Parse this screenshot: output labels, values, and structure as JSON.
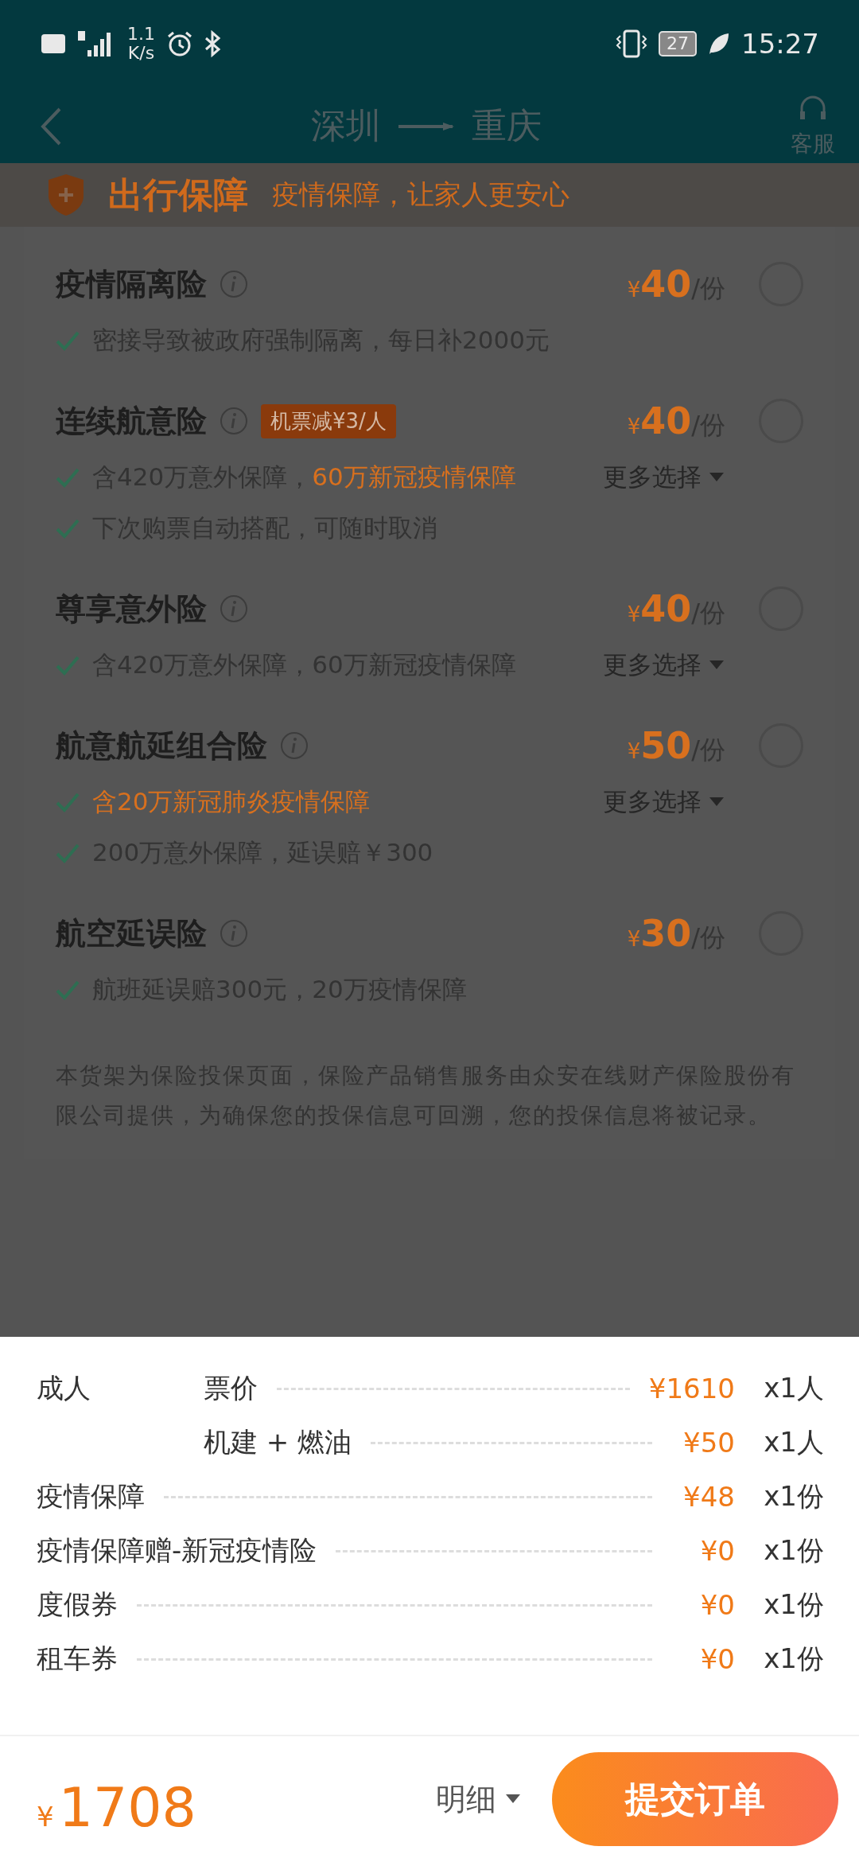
{
  "status_bar": {
    "network_speed": "1.1",
    "speed_unit": "K/s",
    "battery": "27",
    "time": "15:27"
  },
  "header": {
    "from": "深圳",
    "to": "重庆",
    "service_label": "客服"
  },
  "section": {
    "title": "出行保障",
    "subtitle": "疫情保障，让家人更安心"
  },
  "products": [
    {
      "name": "疫情隔离险",
      "currency": "¥",
      "price": "40",
      "unit": "/份",
      "selected": false,
      "lines": [
        {
          "segments": [
            {
              "text": "密接导致被政府强制隔离，每日补2000元",
              "highlight": false
            }
          ]
        }
      ]
    },
    {
      "name": "连续航意险",
      "badge": "机票减¥3/人",
      "currency": "¥",
      "price": "40",
      "unit": "/份",
      "selected": false,
      "lines": [
        {
          "segments": [
            {
              "text": "含420万意外保障，",
              "highlight": false
            },
            {
              "text": "60万新冠疫情保障",
              "highlight": true
            }
          ],
          "more": "更多选择"
        },
        {
          "segments": [
            {
              "text": "下次购票自动搭配，可随时取消",
              "highlight": false
            }
          ]
        }
      ]
    },
    {
      "name": "尊享意外险",
      "currency": "¥",
      "price": "40",
      "unit": "/份",
      "selected": false,
      "lines": [
        {
          "segments": [
            {
              "text": "含420万意外保障，60万新冠疫情保障",
              "highlight": false
            }
          ],
          "more": "更多选择"
        }
      ]
    },
    {
      "name": "航意航延组合险",
      "currency": "¥",
      "price": "50",
      "unit": "/份",
      "selected": false,
      "lines": [
        {
          "segments": [
            {
              "text": "含20万新冠肺炎疫情保障",
              "highlight": true
            }
          ],
          "more": "更多选择"
        },
        {
          "segments": [
            {
              "text": "200万意外保障，延误赔￥300",
              "highlight": false
            }
          ]
        }
      ]
    },
    {
      "name": "航空延误险",
      "currency": "¥",
      "price": "30",
      "unit": "/份",
      "selected": false,
      "lines": [
        {
          "segments": [
            {
              "text": "航班延误赔300元，20万疫情保障",
              "highlight": false
            }
          ]
        }
      ]
    }
  ],
  "disclaimer": "本货架为保险投保页面，保险产品销售服务由众安在线财产保险股份有限公司提供，为确保您的投保信息可回溯，您的投保信息将被记录。",
  "fees": [
    {
      "kind": "passenger",
      "group": "成人",
      "label": "票价",
      "amount": "¥1610",
      "quantity": "x1人"
    },
    {
      "kind": "passenger",
      "label": "机建 + 燃油",
      "amount": "¥50",
      "quantity": "x1人"
    },
    {
      "kind": "item",
      "label": "疫情保障",
      "amount": "¥48",
      "quantity": "x1份"
    },
    {
      "kind": "item",
      "label": "疫情保障赠-新冠疫情险",
      "amount": "¥0",
      "quantity": "x1份"
    },
    {
      "kind": "item",
      "label": "度假券",
      "amount": "¥0",
      "quantity": "x1份"
    },
    {
      "kind": "item",
      "label": "租车券",
      "amount": "¥0",
      "quantity": "x1份"
    }
  ],
  "footer": {
    "currency": "¥",
    "total": "1708",
    "details_label": "明细",
    "submit_label": "提交订单"
  }
}
